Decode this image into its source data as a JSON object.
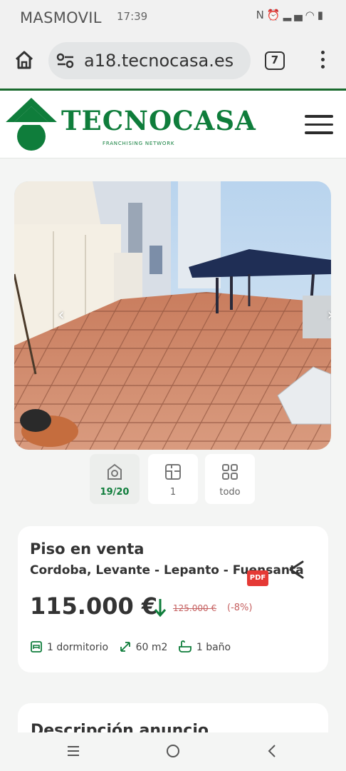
{
  "status_bar": {
    "carrier": "MASMOVIL",
    "time": "17:39",
    "icons": [
      "nfc-icon",
      "alarm-icon",
      "volte-icon",
      "signal-icon",
      "wifi-icon",
      "battery-icon"
    ]
  },
  "browser": {
    "url": "a18.tecnocasa.es",
    "tab_count": "7"
  },
  "site": {
    "brand": "TECNOCASA",
    "tagline": "FRANCHISING NETWORK",
    "brand_color": "#0f7d3b"
  },
  "gallery": {
    "prev_arrow": "‹",
    "next_arrow": "›",
    "tabs": [
      {
        "icon": "camera-icon",
        "label": "19/20"
      },
      {
        "icon": "floorplan-icon",
        "label": "1"
      },
      {
        "icon": "grid-icon",
        "label": "todo"
      }
    ]
  },
  "listing": {
    "title": "Piso en venta",
    "address": "Cordoba, Levante - Lepanto - Fuensanta",
    "pdf_label": "PDF",
    "price": "115.000 €",
    "old_price": "125.000 €",
    "discount": "(-8%)",
    "features": [
      {
        "icon": "bed-icon",
        "label": "1 dormitorio"
      },
      {
        "icon": "area-icon",
        "label": "60 m2"
      },
      {
        "icon": "bath-icon",
        "label": "1 baño"
      }
    ]
  },
  "description": {
    "title": "Descripción anuncio"
  }
}
